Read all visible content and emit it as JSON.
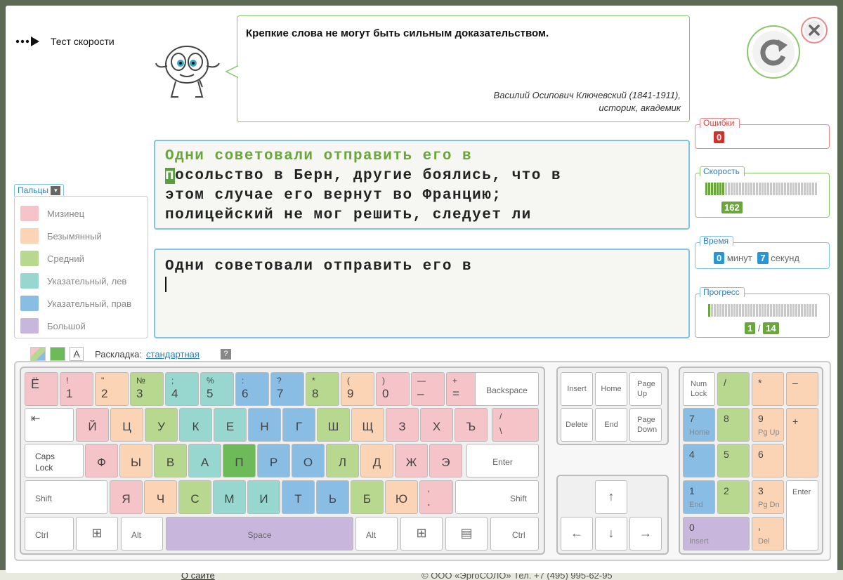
{
  "app": {
    "title": "Тест скорости"
  },
  "quote": {
    "text": "Крепкие слова не могут быть сильным доказательством.",
    "author_line1": "Василий Осипович Ключевский (1841-1911),",
    "author_line2": "историк, академик"
  },
  "source_text": {
    "typed": "Одни советовали отправить его в",
    "current_char": "п",
    "line2_rest": "осольство в Берн, другие боялись, что в",
    "line3": "этом случае его вернут во Францию;",
    "line4": "полицейский не мог решить, следует ли"
  },
  "input_text": {
    "value": "Одни советовали отправить его в"
  },
  "stats": {
    "errors": {
      "label": "Ошибки",
      "value": "0"
    },
    "speed": {
      "label": "Скорость",
      "value": "162",
      "level": 0.18
    },
    "time": {
      "label": "Время",
      "minutes": "0",
      "minutes_label": "минут",
      "seconds": "7",
      "seconds_label": "секунд"
    },
    "progress": {
      "label": "Прогресс",
      "current": "1",
      "separator": "/",
      "total": "14",
      "level": 0.03
    }
  },
  "fingers": {
    "title": "Пальцы",
    "items": [
      {
        "label": "Мизинец",
        "color": "#f5c4c9"
      },
      {
        "label": "Безымянный",
        "color": "#fbd3b5"
      },
      {
        "label": "Средний",
        "color": "#b9d88f"
      },
      {
        "label": "Указательный, лев",
        "color": "#98d7cf"
      },
      {
        "label": "Указательный, прав",
        "color": "#89bde3"
      },
      {
        "label": "Большой",
        "color": "#c8b6dc"
      }
    ]
  },
  "layout_bar": {
    "label": "Раскладка:",
    "value": "стандартная",
    "help": "?",
    "font_btn": "A"
  },
  "keys": {
    "yo": "Ё",
    "n1_top": "!",
    "n1": "1",
    "n2_top": "\"",
    "n2": "2",
    "n3_top": "№",
    "n3": "3",
    "n4_top": ";",
    "n4": "4",
    "n5_top": "%",
    "n5": "5",
    "n6_top": ":",
    "n6": "6",
    "n7_top": "?",
    "n7": "7",
    "n8_top": "*",
    "n8": "8",
    "n9_top": "(",
    "n9": "9",
    "n0_top": ")",
    "n0": "0",
    "minus_top": "—",
    "minus": "–",
    "equals_top": "+",
    "equals": "=",
    "backspace": "Backspace",
    "row1": [
      "Й",
      "Ц",
      "У",
      "К",
      "Е",
      "Н",
      "Г",
      "Ш",
      "Щ",
      "З",
      "Х",
      "Ъ"
    ],
    "slash_top": "/",
    "slash": "\\",
    "caps1": "Caps",
    "caps2": "Lock",
    "row2": [
      "Ф",
      "Ы",
      "В",
      "А",
      "П",
      "Р",
      "О",
      "Л",
      "Д",
      "Ж",
      "Э"
    ],
    "enter": "Enter",
    "shift_l": "Shift",
    "row3": [
      "Я",
      "Ч",
      "С",
      "М",
      "И",
      "Т",
      "Ь",
      "Б",
      "Ю"
    ],
    "comma_top": ",",
    "comma": ".",
    "shift_r": "Shift",
    "ctrl_l": "Ctrl",
    "alt_l": "Alt",
    "space": "Space",
    "alt_r": "Alt",
    "ctrl_r": "Ctrl",
    "insert": "Insert",
    "home": "Home",
    "pgup1": "Page",
    "pgup2": "Up",
    "delete": "Delete",
    "end": "End",
    "pgdn1": "Page",
    "pgdn2": "Down",
    "up": "↑",
    "left": "←",
    "down": "↓",
    "right": "→",
    "numlock1": "Num",
    "numlock2": "Lock",
    "np_div": "/",
    "np_mul": "*",
    "np_minus": "–",
    "np_plus": "+",
    "np7": "7",
    "np7_sub": "Home",
    "np8": "8",
    "np9": "9",
    "np9_sub": "Pg Up",
    "np4": "4",
    "np5": "5",
    "np6": "6",
    "np1": "1",
    "np1_sub": "End",
    "np2": "2",
    "np3": "3",
    "np3_sub": "Pg Dn",
    "np_enter": "Enter",
    "np0": "0",
    "np0_sub": "Insert",
    "np_dot": ",",
    "np_dot_sub": "Del"
  },
  "footer": {
    "about": "О сайте",
    "copyright": "© ООО «ЭргоСОЛО» Тел. +7 (495) 995-62-95"
  }
}
